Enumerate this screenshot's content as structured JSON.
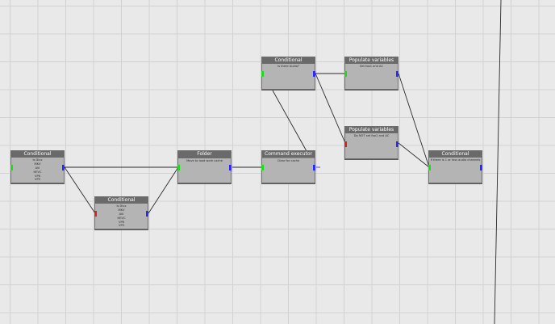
{
  "colors": {
    "background": "#e9e9e9",
    "grid": "#d2d2d2",
    "node_body": "#b4b4b4",
    "node_title": "#6a6a6a",
    "folder_accent": "#5b5bd6",
    "command_accent": "#4aa8a8",
    "port_input": "#2ad22a",
    "port_output": "#2b2bff",
    "port_false": "#e01e1e",
    "wire": "#2a2a2a"
  },
  "nodes": [
    {
      "id": "conditional-1",
      "title": "Conditional",
      "lines": [
        "Is Divx",
        "MKV",
        "AVI",
        "HEVC",
        "VP8",
        "VP9"
      ]
    },
    {
      "id": "conditional-2",
      "title": "Conditional",
      "lines": [
        "Is Divx",
        "MKV",
        "AVI",
        "HEVC",
        "VP8",
        "VP9"
      ]
    },
    {
      "id": "folder",
      "title": "Folder",
      "lines": [
        "Move to load work cache"
      ]
    },
    {
      "id": "conditional-3",
      "title": "Conditional",
      "lines": [
        "Is there Audio?"
      ]
    },
    {
      "id": "command-executor",
      "title": "Command executor",
      "lines": [
        "Clear for cache"
      ]
    },
    {
      "id": "populate-1",
      "title": "Populate variables",
      "lines": [
        "Set foo1 and AC"
      ]
    },
    {
      "id": "populate-2",
      "title": "Populate variables",
      "lines": [
        "Do NOT set foo1 and AC"
      ]
    },
    {
      "id": "conditional-4",
      "title": "Conditional",
      "lines": [
        "If there is 1 or less audio channels"
      ]
    }
  ]
}
